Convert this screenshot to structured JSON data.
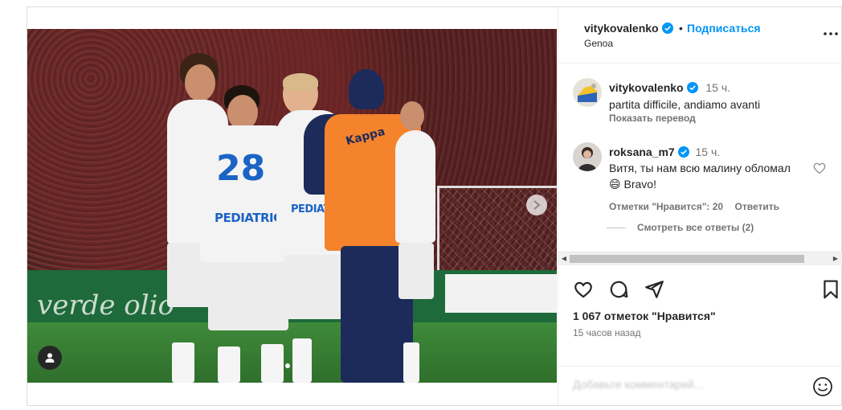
{
  "post": {
    "author": {
      "username": "vitykovalenko",
      "verified": true,
      "follow_label": "Подписаться",
      "separator": "•",
      "location": "Genoa"
    },
    "media": {
      "hoarding_text": "verde olio",
      "sponsor": "PEDIATRICA",
      "vest_text": "Kappa",
      "shirt_number": "28",
      "carousel_index": 1,
      "carousel_count": 2
    },
    "caption": {
      "username": "vitykovalenko",
      "time": "15 ч.",
      "text": "partita difficile, andiamo avanti",
      "translate_label": "Показать перевод"
    },
    "comments": [
      {
        "username": "roksana_m7",
        "verified": true,
        "time": "15 ч.",
        "text_line1": "Витя, ты нам всю малину обломал",
        "emoji": "😄",
        "text_line2": "Bravo!",
        "likes_label": "Отметки \"Нравится\": 20",
        "reply_label": "Ответить",
        "view_replies_label": "Смотреть все ответы (2)"
      }
    ],
    "likes_text": "1 067 отметок \"Нравится\"",
    "timestamp": "15 часов назад",
    "comment_input": {
      "placeholder": "Добавьте комментарий..."
    },
    "colors": {
      "link_blue": "#0095f6",
      "verified_blue": "#0095f6",
      "text": "#262626",
      "secondary_text": "#737373"
    }
  }
}
